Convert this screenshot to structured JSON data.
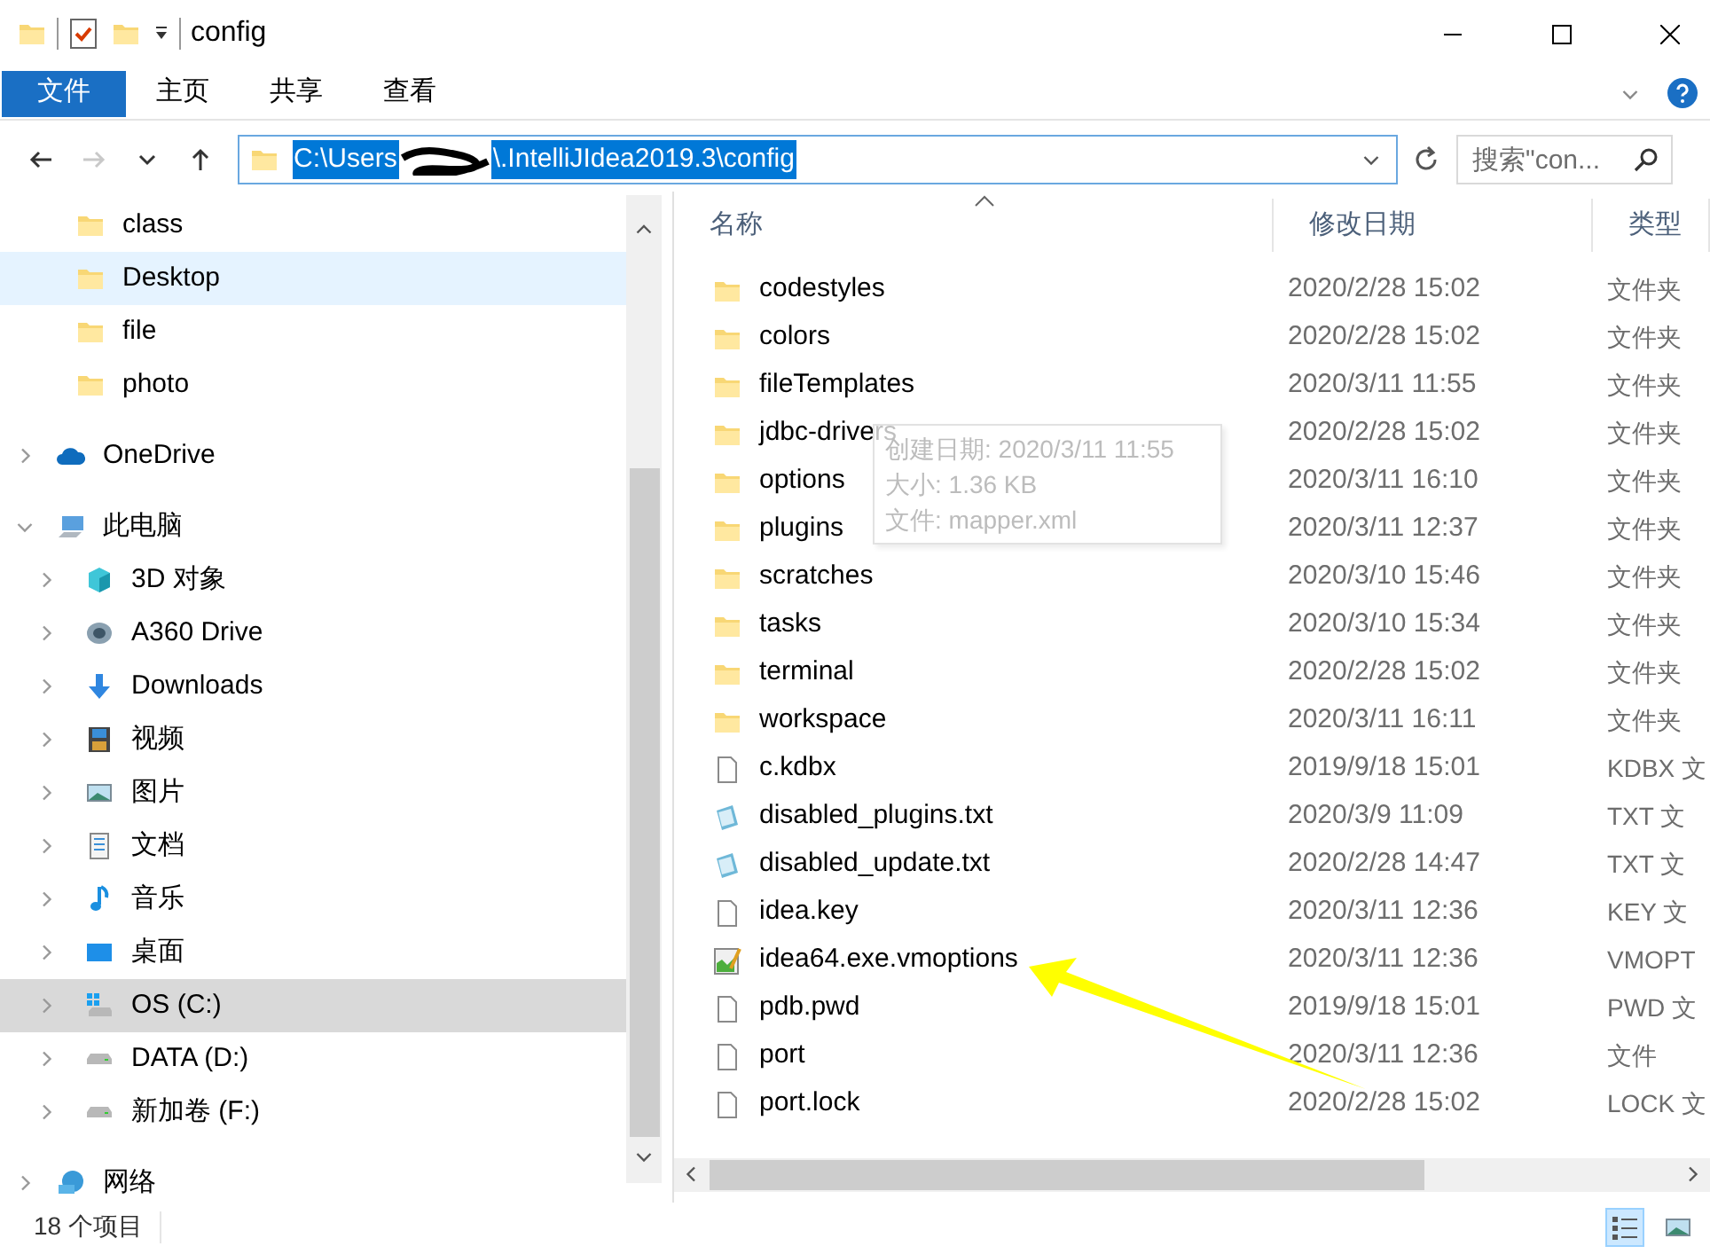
{
  "window": {
    "title": "config"
  },
  "ribbon_tabs": [
    {
      "label": "文件",
      "kind": "file"
    },
    {
      "label": "主页",
      "kind": "plain"
    },
    {
      "label": "共享",
      "kind": "plain"
    },
    {
      "label": "查看",
      "kind": "plain"
    }
  ],
  "nav_buttons": [
    {
      "kind": "back",
      "disabled": false
    },
    {
      "kind": "forward",
      "disabled": true
    },
    {
      "kind": "recent",
      "disabled": false
    },
    {
      "kind": "up",
      "disabled": false
    }
  ],
  "address_bar": {
    "path_start": "C:\\Users",
    "path_end": "\\.IntelliJIdea2019.3\\config",
    "selected": true
  },
  "search": {
    "placeholder": "搜索\"con..."
  },
  "sidebar": {
    "quick_access": [
      {
        "label": "class",
        "kind": "folder",
        "selected": false,
        "hovered": false
      },
      {
        "label": "Desktop",
        "kind": "folder",
        "selected": false,
        "hovered": true
      },
      {
        "label": "file",
        "kind": "folder",
        "selected": false,
        "hovered": false
      },
      {
        "label": "photo",
        "kind": "folder",
        "selected": false,
        "hovered": false
      }
    ],
    "tree": [
      {
        "label": "OneDrive",
        "kind": "onedrive",
        "expanded": false,
        "selected": false,
        "hovered": false
      },
      {
        "label": "此电脑",
        "kind": "pc",
        "expanded": true,
        "selected": false,
        "hovered": false,
        "children": [
          {
            "label": "3D 对象",
            "kind": "objects3d",
            "expanded": false,
            "selected": false,
            "hovered": false
          },
          {
            "label": "A360 Drive",
            "kind": "a360",
            "expanded": false,
            "selected": false,
            "hovered": false
          },
          {
            "label": "Downloads",
            "kind": "downloads",
            "expanded": false,
            "selected": false,
            "hovered": false
          },
          {
            "label": "视频",
            "kind": "videos",
            "expanded": false,
            "selected": false,
            "hovered": false
          },
          {
            "label": "图片",
            "kind": "pictures",
            "expanded": false,
            "selected": false,
            "hovered": false
          },
          {
            "label": "文档",
            "kind": "documents",
            "expanded": false,
            "selected": false,
            "hovered": false
          },
          {
            "label": "音乐",
            "kind": "music",
            "expanded": false,
            "selected": false,
            "hovered": false
          },
          {
            "label": "桌面",
            "kind": "desktop",
            "expanded": false,
            "selected": false,
            "hovered": false
          },
          {
            "label": "OS (C:)",
            "kind": "os_drive",
            "expanded": false,
            "selected": true,
            "hovered": false
          },
          {
            "label": "DATA (D:)",
            "kind": "drive",
            "expanded": false,
            "selected": false,
            "hovered": false
          },
          {
            "label": "新加卷 (F:)",
            "kind": "drive",
            "expanded": false,
            "selected": false,
            "hovered": false
          }
        ]
      },
      {
        "label": "网络",
        "kind": "network",
        "expanded": false,
        "selected": false,
        "hovered": false
      }
    ]
  },
  "file_list": {
    "columns": [
      {
        "label": "名称",
        "sorted": true
      },
      {
        "label": "修改日期",
        "sorted": false
      },
      {
        "label": "类型",
        "sorted": false
      }
    ],
    "rows": [
      {
        "name": "codestyles",
        "modified": "2020/2/28 15:02",
        "type": "文件夹",
        "kind": "folder"
      },
      {
        "name": "colors",
        "modified": "2020/2/28 15:02",
        "type": "文件夹",
        "kind": "folder"
      },
      {
        "name": "fileTemplates",
        "modified": "2020/3/11 11:55",
        "type": "文件夹",
        "kind": "folder"
      },
      {
        "name": "jdbc-drivers",
        "modified": "2020/2/28 15:02",
        "type": "文件夹",
        "kind": "folder"
      },
      {
        "name": "options",
        "modified": "2020/3/11 16:10",
        "type": "文件夹",
        "kind": "folder"
      },
      {
        "name": "plugins",
        "modified": "2020/3/11 12:37",
        "type": "文件夹",
        "kind": "folder"
      },
      {
        "name": "scratches",
        "modified": "2020/3/10 15:46",
        "type": "文件夹",
        "kind": "folder"
      },
      {
        "name": "tasks",
        "modified": "2020/3/10 15:34",
        "type": "文件夹",
        "kind": "folder"
      },
      {
        "name": "terminal",
        "modified": "2020/2/28 15:02",
        "type": "文件夹",
        "kind": "folder"
      },
      {
        "name": "workspace",
        "modified": "2020/3/11 16:11",
        "type": "文件夹",
        "kind": "folder"
      },
      {
        "name": "c.kdbx",
        "modified": "2019/9/18 15:01",
        "type": "KDBX 文",
        "kind": "file"
      },
      {
        "name": "disabled_plugins.txt",
        "modified": "2020/3/9 11:09",
        "type": "TXT 文",
        "kind": "text"
      },
      {
        "name": "disabled_update.txt",
        "modified": "2020/2/28 14:47",
        "type": "TXT 文",
        "kind": "text"
      },
      {
        "name": "idea.key",
        "modified": "2020/3/11 12:36",
        "type": "KEY 文",
        "kind": "file"
      },
      {
        "name": "idea64.exe.vmoptions",
        "modified": "2020/3/11 12:36",
        "type": "VMOPT",
        "kind": "vmoptions"
      },
      {
        "name": "pdb.pwd",
        "modified": "2019/9/18 15:01",
        "type": "PWD 文",
        "kind": "file"
      },
      {
        "name": "port",
        "modified": "2020/3/11 12:36",
        "type": "文件",
        "kind": "file"
      },
      {
        "name": "port.lock",
        "modified": "2020/2/28 15:02",
        "type": "LOCK 文",
        "kind": "file"
      }
    ]
  },
  "tooltip": {
    "lines": [
      "创建日期: 2020/3/11 11:55",
      "大小: 1.36 KB",
      "文件: mapper.xml"
    ]
  },
  "status_bar": {
    "item_count": "18 个项目",
    "views": [
      {
        "kind": "details",
        "selected": true
      },
      {
        "kind": "large_icons",
        "selected": false
      }
    ]
  }
}
